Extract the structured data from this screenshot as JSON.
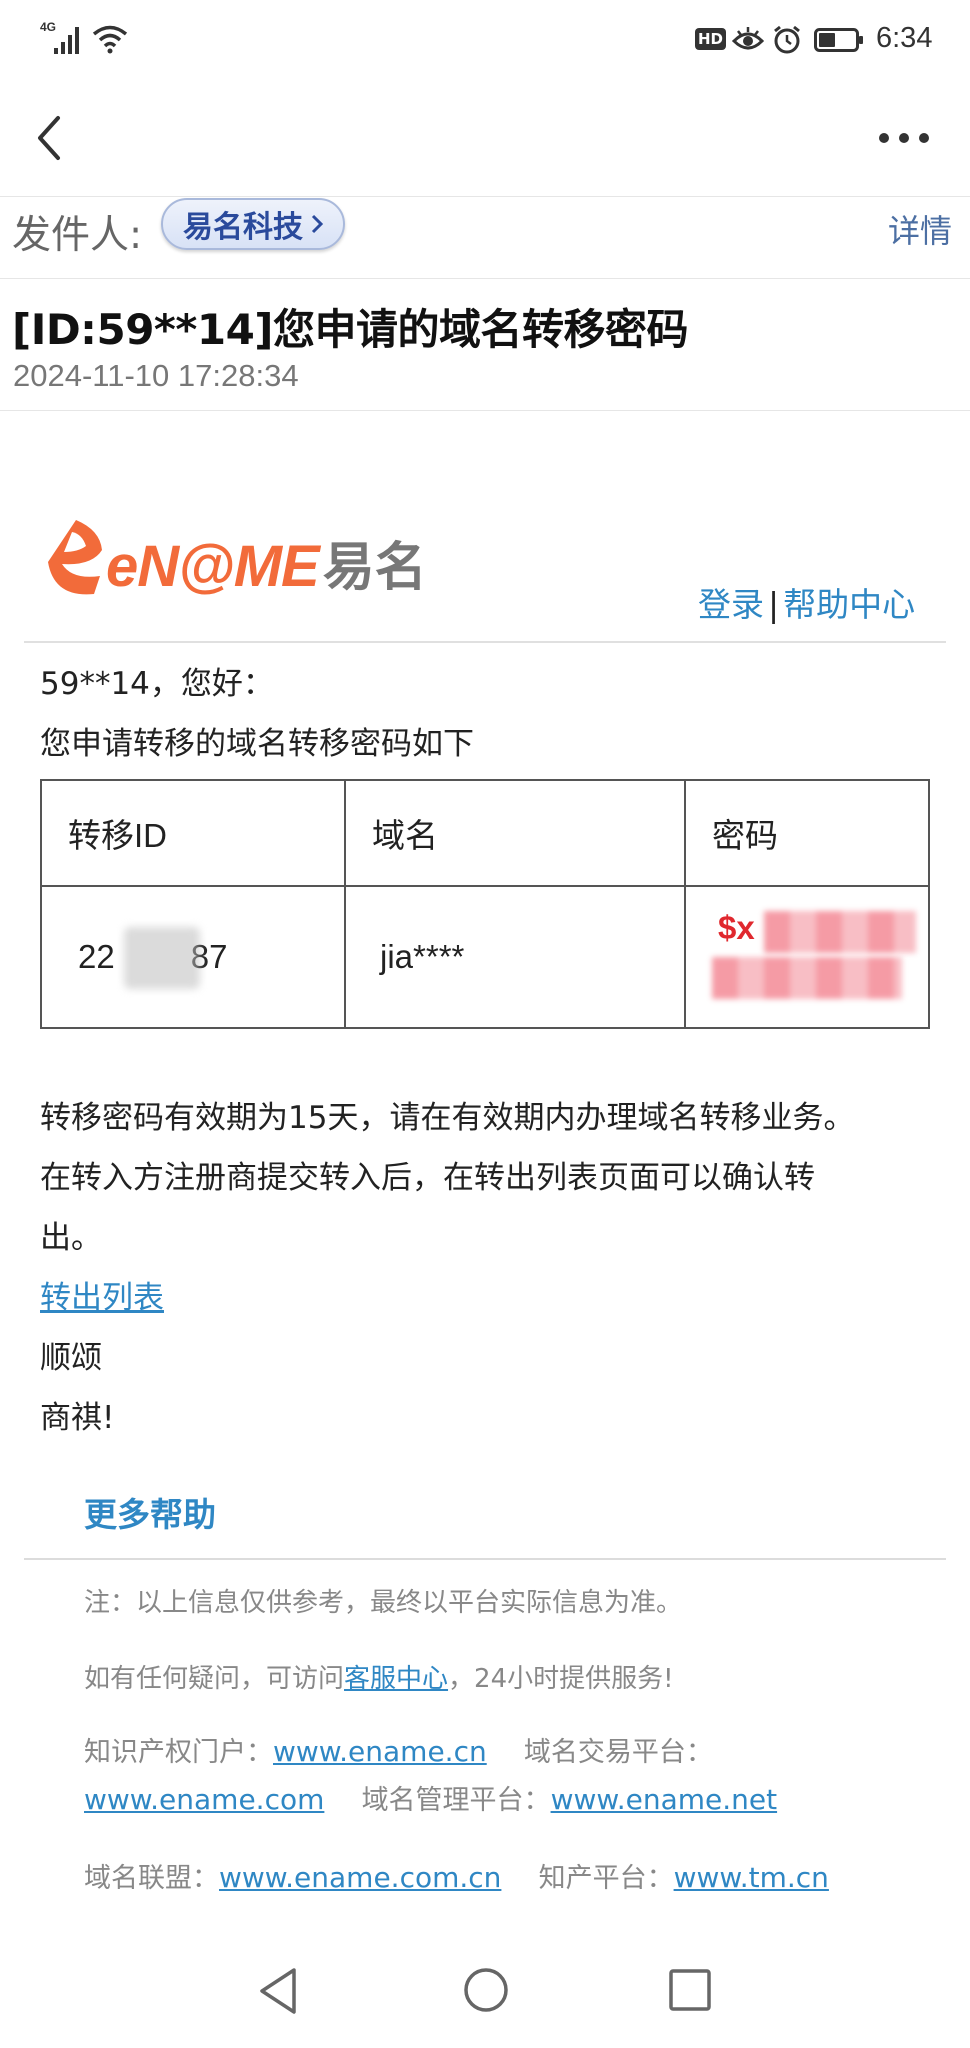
{
  "status_bar": {
    "signal": "4G",
    "time": "6:34",
    "hd_badge": "HD"
  },
  "toolbar": {
    "back_icon": "chevron-left-icon",
    "more_icon": "more-horizontal-icon"
  },
  "sender": {
    "label": "发件人:",
    "name": "易名科技",
    "detail": "详情"
  },
  "email": {
    "subject": "[ID:59**14]您申请的域名转移密码",
    "date": "2024-11-10 17:28:34"
  },
  "content": {
    "logo_text": "eN@ME",
    "logo_cn": "易名",
    "login": "登录",
    "separator": "|",
    "help_center": "帮助中心",
    "greeting": "59**14，您好：",
    "intro": "您申请转移的域名转移密码如下",
    "table": {
      "headers": [
        "转移ID",
        "域名",
        "密码"
      ],
      "row": {
        "id_prefix": "22",
        "id_suffix": "87",
        "domain": "jia****",
        "password_prefix": "$x"
      }
    },
    "para1": "转移密码有效期为15天，请在有效期内办理域名转移业务。",
    "para2_line1": "在转入方注册商提交转入后，在转出列表页面可以确认转",
    "para2_line2": "出。",
    "transfer_link": "转出列表",
    "closing1": "顺颂",
    "closing2": "商祺!",
    "more_help": "更多帮助",
    "note": "注：以上信息仅供参考，最终以平台实际信息为准。",
    "service_prefix": "如有任何疑问，可访问",
    "service_link": "客服中心",
    "service_suffix": "，24小时提供服务!",
    "footer": {
      "ip_label": "知识产权门户：",
      "ip_url": "www.ename.cn",
      "trade_label": "域名交易平台：",
      "trade_url": "www.ename.com",
      "manage_label": "域名管理平台：",
      "manage_url": "www.ename.net",
      "union_label": "域名联盟：",
      "union_url": "www.ename.com.cn",
      "tm_label": "知产平台：",
      "tm_url": "www.tm.cn"
    }
  },
  "colors": {
    "accent_link": "#2f87c4",
    "logo_orange": "#f26b3a",
    "chip_text": "#2a4a9c"
  },
  "nav_bar": {
    "back": "triangle-back-icon",
    "home": "circle-home-icon",
    "recents": "square-recents-icon"
  }
}
